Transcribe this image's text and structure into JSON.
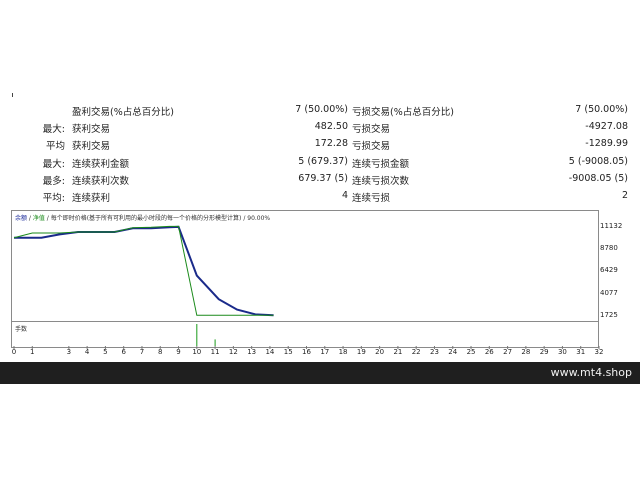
{
  "report": {
    "rows": [
      {
        "prefix": "",
        "label": "盈利交易(%占总百分比)",
        "value": "7 (50.00%)",
        "label2": "亏损交易(%占总百分比)",
        "value2": "7 (50.00%)"
      },
      {
        "prefix": "最大:",
        "label": "获利交易",
        "value": "482.50",
        "label2": "亏损交易",
        "value2": "-4927.08"
      },
      {
        "prefix": "平均",
        "label": "获利交易",
        "value": "172.28",
        "label2": "亏损交易",
        "value2": "-1289.99"
      },
      {
        "prefix": "最大:",
        "label": "连续获利金额",
        "value": "5 (679.37)",
        "label2": "连续亏损金额",
        "value2": "5 (-9008.05)"
      },
      {
        "prefix": "最多:",
        "label": "连续获利次数",
        "value": "679.37 (5)",
        "label2": "连续亏损次数",
        "value2": "-9008.05 (5)"
      },
      {
        "prefix": "平均:",
        "label": "连续获利",
        "value": "4",
        "label2": "连续亏损",
        "value2": "2"
      }
    ]
  },
  "chart_data": {
    "type": "line",
    "header": {
      "balance": "余额",
      "sep1": " / ",
      "equity": "净值",
      "sep2": " / ",
      "desc": "每个即时价格(基于所有可利用的最小时段的每一个价格的分形模型计算)",
      "sep3": " / ",
      "quality": "90.00%"
    },
    "yticks": [
      11132,
      8780,
      6429,
      4077,
      1725
    ],
    "ylim": [
      1725,
      11132
    ],
    "xticks": [
      0,
      1,
      3,
      4,
      5,
      6,
      7,
      8,
      9,
      10,
      11,
      12,
      13,
      14,
      15,
      16,
      17,
      18,
      19,
      20,
      21,
      22,
      23,
      24,
      25,
      26,
      27,
      28,
      29,
      30,
      31,
      32
    ],
    "xlim": [
      0,
      32
    ],
    "grid": false,
    "series": [
      {
        "color": "#1a2a8a",
        "x": [
          0,
          1.5,
          2.5,
          3.5,
          4.5,
          5.5,
          6.5,
          7.5,
          8.5,
          9.0,
          10.0,
          11.2,
          12.2,
          13.2,
          14.2
        ],
        "y": [
          10000,
          10000,
          10350,
          10600,
          10600,
          10600,
          11000,
          11000,
          11100,
          11150,
          6000,
          3500,
          2400,
          1900,
          1800
        ]
      },
      {
        "color": "#1a8a1a",
        "x": [
          0,
          1.0,
          2.5,
          3.5,
          4.5,
          5.5,
          6.5,
          7.5,
          8.5,
          9.0,
          10.0,
          11.0,
          12.0,
          13.0,
          14.2
        ],
        "y": [
          10000,
          10500,
          10500,
          10600,
          10600,
          10600,
          11050,
          11100,
          11200,
          11200,
          1800,
          1800,
          1800,
          1800,
          1800
        ]
      }
    ],
    "volume": {
      "label": "手数",
      "x": [
        10.0,
        11.0
      ],
      "values": [
        1.0,
        0.3
      ]
    }
  },
  "footer": {
    "site": "www.mt4.shop"
  }
}
